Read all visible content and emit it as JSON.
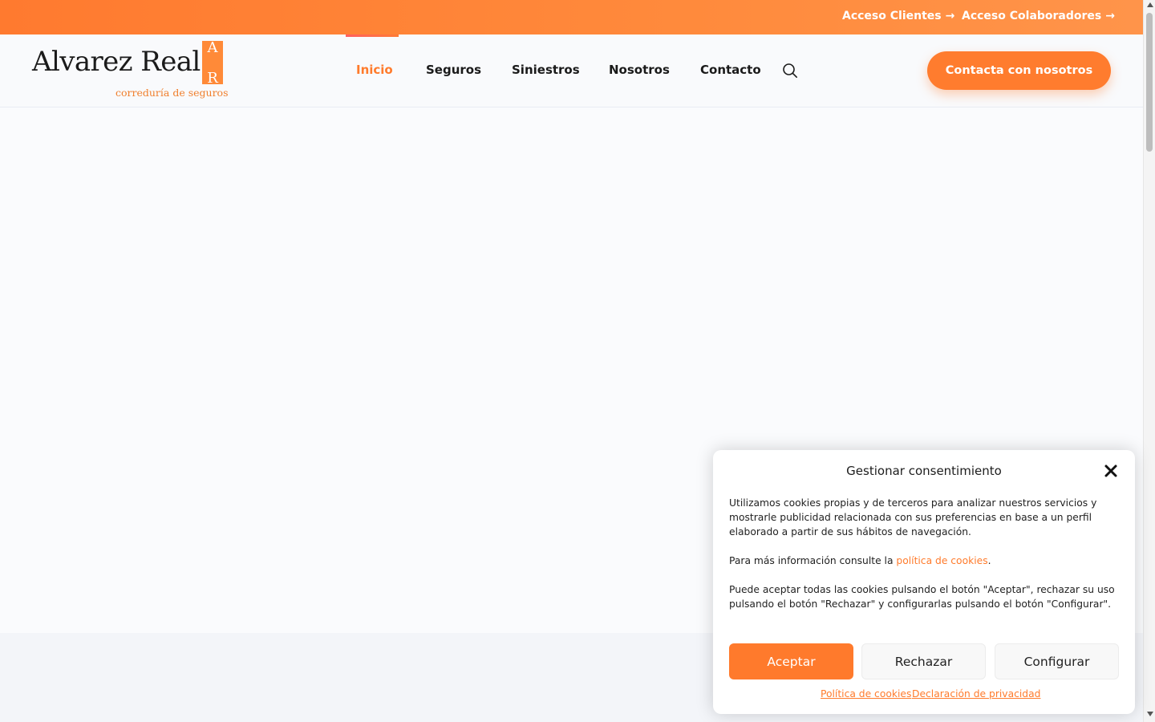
{
  "topbar": {
    "links": [
      {
        "label": "Acceso Clientes",
        "arrow": "→"
      },
      {
        "label": "Acceso Colaboradores",
        "arrow": "→"
      }
    ]
  },
  "logo": {
    "name": "Alvarez Real",
    "tagline": "correduría de seguros",
    "mark_letters": [
      "A",
      "R"
    ]
  },
  "nav": {
    "items": [
      {
        "label": "Inicio",
        "active": true
      },
      {
        "label": "Seguros",
        "active": false
      },
      {
        "label": "Siniestros",
        "active": false
      },
      {
        "label": "Nosotros",
        "active": false
      },
      {
        "label": "Contacto",
        "active": false
      }
    ],
    "search_icon": "search-icon",
    "cta_label": "Contacta con nosotros"
  },
  "cookie": {
    "title": "Gestionar consentimiento",
    "close_icon": "close-icon",
    "p1": "Utilizamos cookies propias y de terceros para analizar nuestros servicios y mostrarle publicidad relacionada con sus preferencias en base a un perfil elaborado a partir de sus hábitos de navegación.",
    "p2_prefix": "Para más información consulte la ",
    "p2_link": "política de cookies",
    "p2_suffix": ".",
    "p3": "Puede aceptar todas las cookies pulsando el botón \"Aceptar\", rechazar su uso pulsando el botón \"Rechazar\" y configurarlas pulsando el botón \"Configurar\".",
    "buttons": {
      "accept": "Aceptar",
      "reject": "Rechazar",
      "configure": "Configurar"
    },
    "links": {
      "cookie_policy": "Política de cookies",
      "privacy": "Declaración de privacidad"
    }
  },
  "colors": {
    "accent": "#ff7b2c",
    "topbar": "#ff8a3c",
    "text": "#1a1a1a"
  }
}
